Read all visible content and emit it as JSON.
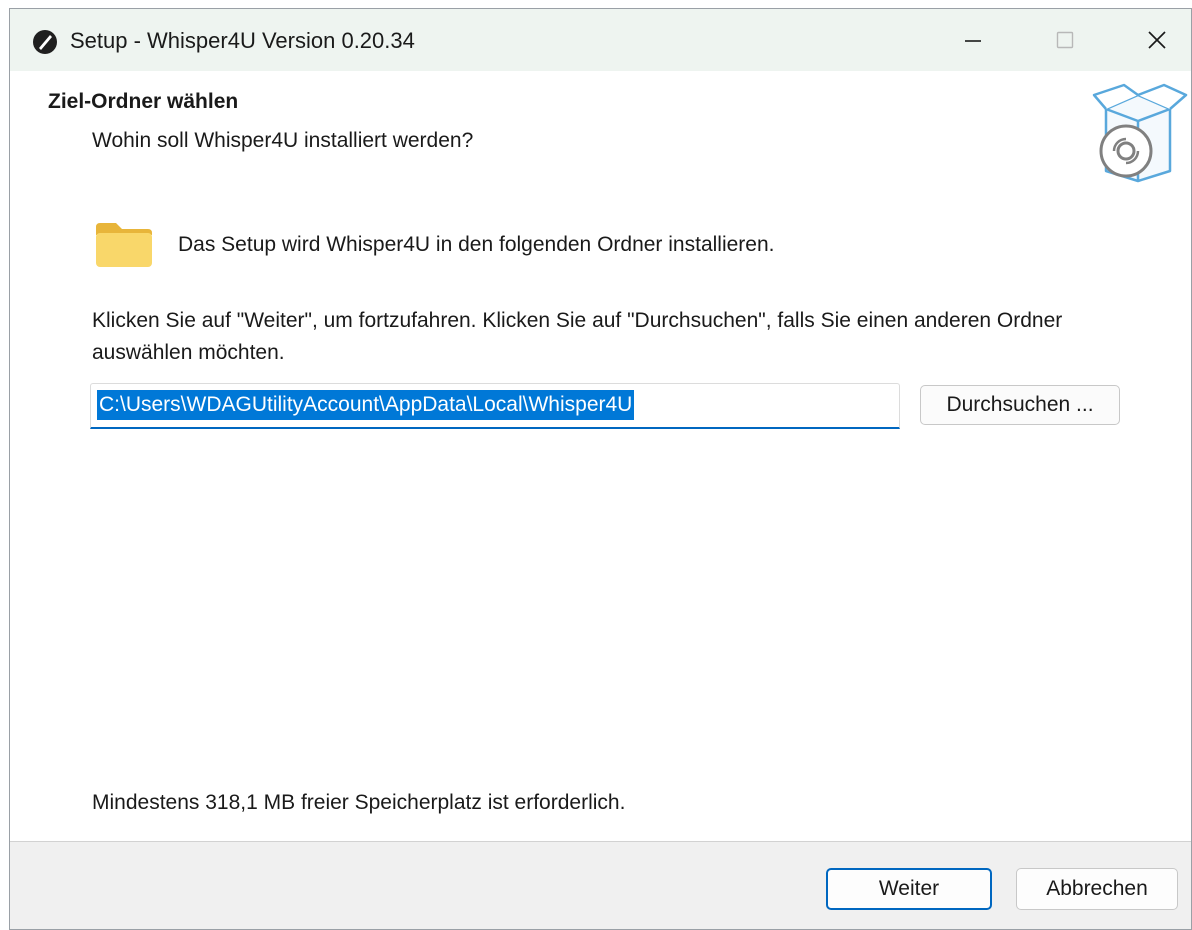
{
  "window": {
    "title": "Setup - Whisper4U Version 0.20.34",
    "app_icon": "whisper4u-app-icon",
    "controls": {
      "minimize_icon": "minimize-icon",
      "maximize_icon": "maximize-icon",
      "close_icon": "close-icon"
    }
  },
  "header": {
    "title": "Ziel-Ordner wählen",
    "subtitle": "Wohin soll Whisper4U installiert werden?",
    "graphic": "setup-box-disc-icon"
  },
  "main": {
    "folder_icon": "folder-icon",
    "install_info": "Das Setup wird Whisper4U in den folgenden Ordner installieren.",
    "instructions": "Klicken Sie auf \"Weiter\", um fortzufahren. Klicken Sie auf \"Durchsuchen\", falls Sie einen anderen Ordner auswählen möchten.",
    "path_value": "C:\\Users\\WDAGUtilityAccount\\AppData\\Local\\Whisper4U",
    "browse_label": "Durchsuchen ...",
    "space_info": "Mindestens 318,1 MB freier Speicherplatz ist erforderlich."
  },
  "footer": {
    "next_label": "Weiter",
    "cancel_label": "Abbrechen"
  },
  "colors": {
    "accent": "#0067c0",
    "selection": "#0078d7",
    "titlebar": "#eef4f0",
    "footer": "#f0f0f0"
  }
}
